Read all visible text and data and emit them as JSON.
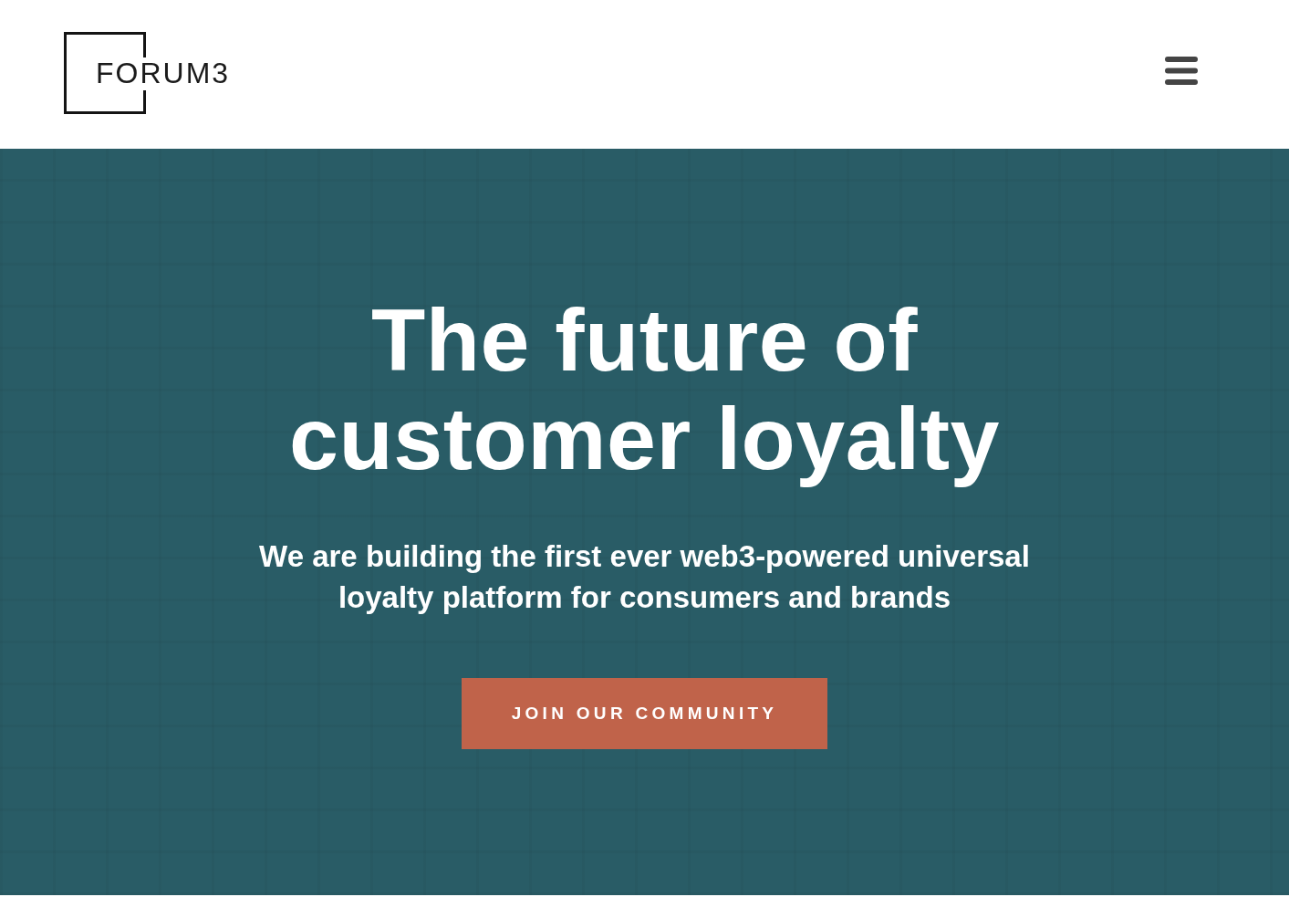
{
  "header": {
    "logo": {
      "text": "FORUM3"
    }
  },
  "hero": {
    "title": "The future of customer loyalty",
    "subtitle": "We are building the first ever web3-powered universal loyalty platform for consumers and brands",
    "cta": {
      "label": "JOIN OUR COMMUNITY"
    }
  }
}
